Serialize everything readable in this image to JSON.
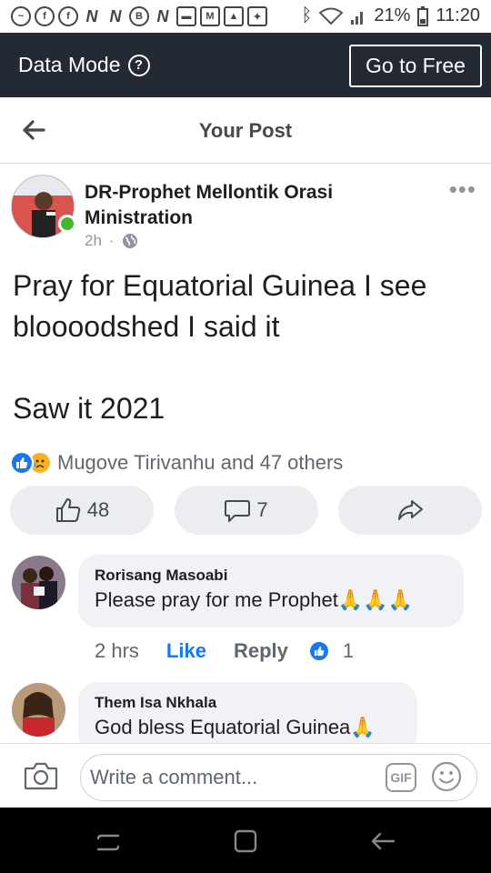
{
  "status_bar": {
    "battery": "21%",
    "time": "11:20"
  },
  "data_bar": {
    "label": "Data Mode",
    "cta": "Go to Free"
  },
  "header": {
    "title": "Your Post"
  },
  "post": {
    "author": "DR-Prophet Mellontik Orasi Ministration",
    "time": "2h",
    "lines": [
      "Pray for Equatorial Guinea I see bloooodshed I said it",
      "",
      "Saw it 2021"
    ],
    "reactions_text": "Mugove Tirivanhu and 47 others",
    "like_count": "48",
    "comment_count": "7"
  },
  "comments": [
    {
      "name": "Rorisang Masoabi",
      "text": "Please pray for me Prophet",
      "emoji": "🙏🙏🙏",
      "time": "2 hrs",
      "like_label": "Like",
      "reply_label": "Reply",
      "likes": "1"
    },
    {
      "name": "Them Isa Nkhala",
      "text": "God bless Equatorial Guinea",
      "emoji": "🙏"
    }
  ],
  "compose": {
    "placeholder": "Write a comment..."
  },
  "colors": {
    "accent": "#1877f2",
    "dark_bar": "#232a33",
    "online": "#42b72a"
  }
}
